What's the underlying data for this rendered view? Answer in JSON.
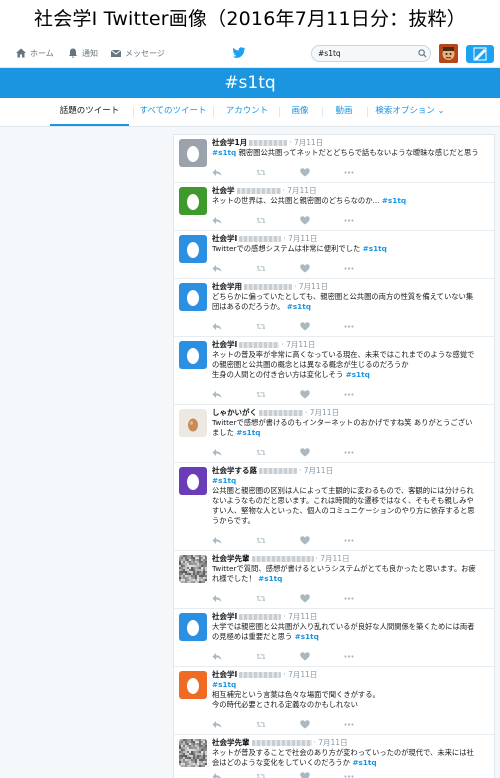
{
  "caption": "社会学Ⅰ Twitter画像（2016年7月11日分：抜粋）",
  "topnav": {
    "home_label": "ホーム",
    "notifications_label": "通知",
    "messages_label": "メッセージ",
    "search_value": "#s1tq"
  },
  "hashtag_title": "#s1tq",
  "tabs": [
    {
      "label": "話題のツイート"
    },
    {
      "label": "すべてのツイート"
    },
    {
      "label": "アカウント"
    },
    {
      "label": "画像"
    },
    {
      "label": "動画"
    },
    {
      "label": "検索オプション ⌄"
    }
  ],
  "colors": {
    "brand": "#1da1f2",
    "header_bar": "#1b95e0",
    "link": "#1b95e0"
  },
  "tweets": [
    {
      "name": "社会学1月",
      "time": "7月11日",
      "avatar": "gray",
      "lines": [
        [
          "#s1tq",
          " 親密圏公共圏ってネットだとどちらで話もないような曖昧な感じだと思う"
        ]
      ]
    },
    {
      "name": "社会学",
      "time": "7月11日",
      "avatar": "green",
      "lines": [
        [
          "",
          "ネットの世界は、公共圏と親密圏のどちらなのか... ",
          "#s1tq"
        ]
      ]
    },
    {
      "name": "社会学Ⅰ",
      "time": "7月11日",
      "avatar": "blue",
      "lines": [
        [
          "",
          "Twitterでの感想システムは非常に便利でした ",
          "#s1tq"
        ]
      ]
    },
    {
      "name": "社会学用",
      "time": "7月11日",
      "avatar": "blue",
      "lines": [
        [
          "",
          "どちらかに偏っていたとしても、親密圏と公共圏の両方の性質を備えていない集"
        ],
        [
          "",
          "団はあるのだろうか。 ",
          "#s1tq"
        ]
      ]
    },
    {
      "name": "社会学Ⅰ",
      "time": "7月11日",
      "avatar": "blue",
      "lines": [
        [
          "",
          "ネットの普及率が非常に高くなっている現在、未来ではこれまでのような感覚で"
        ],
        [
          "",
          "の親密圏と公共圏の概念とは異なる概念が生じるのだろうか"
        ],
        [
          "",
          "生身の人間との付き合い方は変化しそう ",
          "#s1tq"
        ]
      ]
    },
    {
      "name": "しゃかいがく",
      "time": "7月11日",
      "avatar": "egg",
      "lines": [
        [
          "",
          "Twitterで感想が書けるのもインターネットのおかげですね笑 ありがとうござい"
        ],
        [
          "",
          "ました ",
          "#s1tq"
        ]
      ]
    },
    {
      "name": "社会学する蕗",
      "time": "7月11日",
      "avatar": "purple",
      "lines": [
        [
          "#s1tq",
          ""
        ],
        [
          "",
          "公共圏と親密圏の区別は人によって主観的に変わるもので、客観的には分けられ"
        ],
        [
          "",
          "ないようなものだと思います。これは時間的な遷移ではなく、そもそも親しみや"
        ],
        [
          "",
          "すい人、堅物な人といった、個人のコミュニケーションのやり方に依存すると思"
        ],
        [
          "",
          "うからです。"
        ]
      ]
    },
    {
      "name": "社会学先輩",
      "time": "7月11日",
      "avatar": "noise",
      "lines": [
        [
          "",
          "Twitterで質問、感想が書けるというシステムがとても良かったと思います。お疲"
        ],
        [
          "",
          "れ様でした！ ",
          "#s1tq"
        ]
      ]
    },
    {
      "name": "社会学Ⅰ",
      "time": "7月11日",
      "avatar": "blue",
      "lines": [
        [
          "",
          "大学では親密圏と公共圏が入り乱れているが良好な人間関係を築くためには両者"
        ],
        [
          "",
          "の見極めは重要だと思う ",
          "#s1tq"
        ]
      ]
    },
    {
      "name": "社会学I",
      "time": "7月11日",
      "avatar": "orange",
      "lines": [
        [
          "#s1tq",
          ""
        ],
        [
          "",
          "相互補完という言葉は色々な場面で聞くきがする。"
        ],
        [
          "",
          "今の時代必要とされる定義なのかもしれない"
        ]
      ]
    },
    {
      "name": "社会学先輩",
      "time": "7月11日",
      "avatar": "noise",
      "lines": [
        [
          "",
          "ネットが普及することで社会のあり方が変わっていったのが現代で、未来には社"
        ],
        [
          "",
          "会はどのような変化をしていくのだろうか ",
          "#s1tq"
        ]
      ]
    }
  ]
}
